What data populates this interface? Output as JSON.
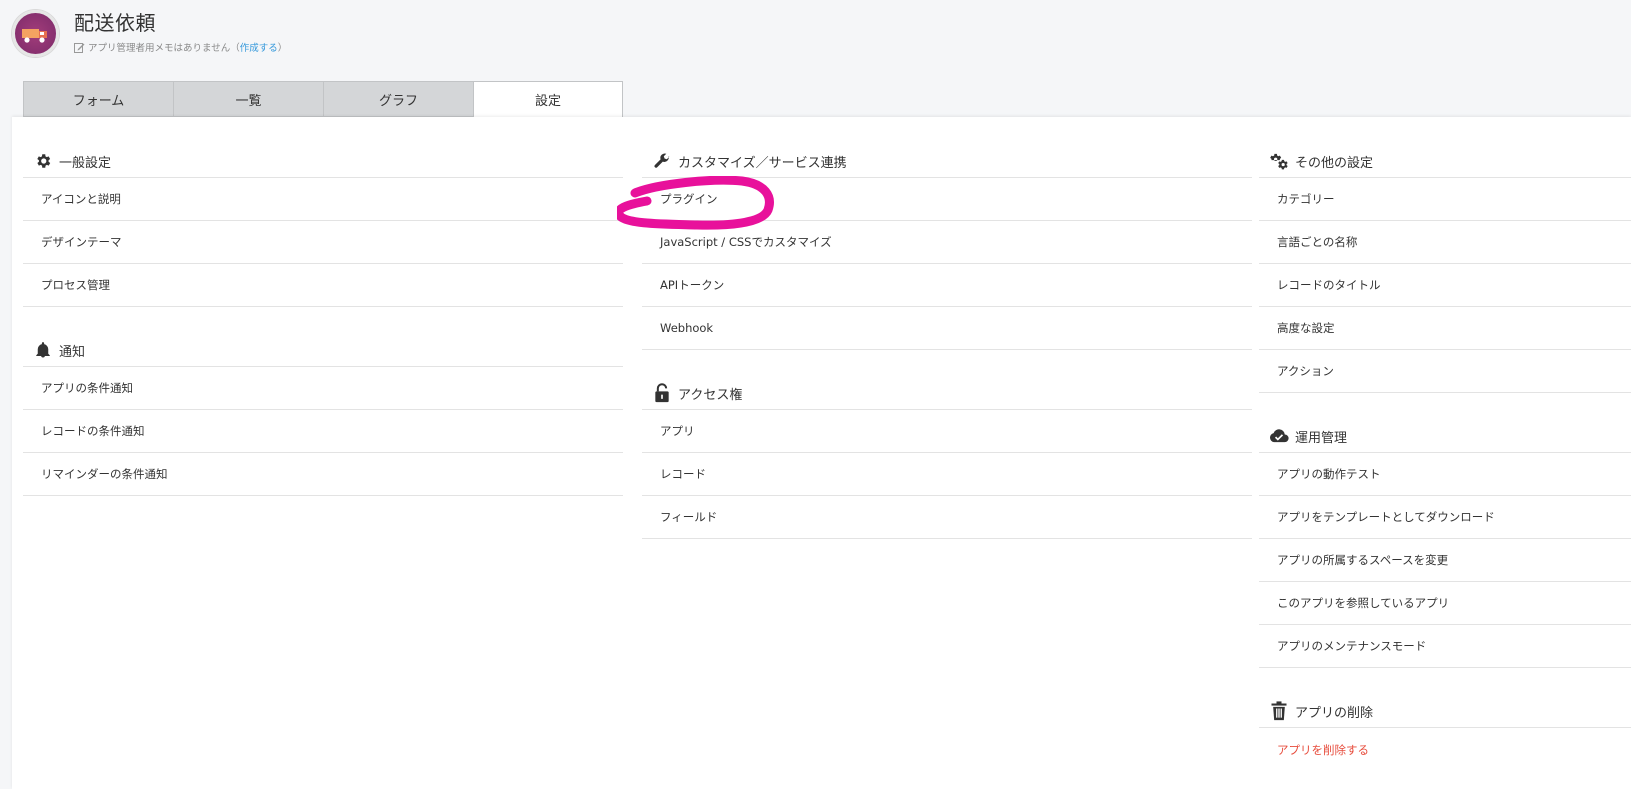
{
  "app": {
    "title": "配送依頼",
    "memo_text": "アプリ管理者用メモはありません",
    "memo_open": "（",
    "memo_link": "作成する",
    "memo_close": "）"
  },
  "tabs": [
    {
      "label": "フォーム"
    },
    {
      "label": "一覧"
    },
    {
      "label": "グラフ"
    },
    {
      "label": "設定"
    }
  ],
  "columns": {
    "general": {
      "title": "一般設定",
      "icon": "gear-icon",
      "items": [
        "アイコンと説明",
        "デザインテーマ",
        "プロセス管理"
      ]
    },
    "notify": {
      "title": "通知",
      "icon": "bell-icon",
      "items": [
        "アプリの条件通知",
        "レコードの条件通知",
        "リマインダーの条件通知"
      ]
    },
    "customize": {
      "title": "カスタマイズ／サービス連携",
      "icon": "wrench-icon",
      "items": [
        "プラグイン",
        "JavaScript / CSSでカスタマイズ",
        "APIトークン",
        "Webhook"
      ]
    },
    "access": {
      "title": "アクセス権",
      "icon": "unlock-icon",
      "items": [
        "アプリ",
        "レコード",
        "フィールド"
      ]
    },
    "other": {
      "title": "その他の設定",
      "icon": "gears-icon",
      "items": [
        "カテゴリー",
        "言語ごとの名称",
        "レコードのタイトル",
        "高度な設定",
        "アクション"
      ]
    },
    "operation": {
      "title": "運用管理",
      "icon": "cloud-check-icon",
      "items": [
        "アプリの動作テスト",
        "アプリをテンプレートとしてダウンロード",
        "アプリの所属するスペースを変更",
        "このアプリを参照しているアプリ",
        "アプリのメンテナンスモード"
      ]
    },
    "delete": {
      "title": "アプリの削除",
      "icon": "trash-icon",
      "items": [
        "アプリを削除する"
      ]
    }
  },
  "colors": {
    "annotation": "#e8119b",
    "danger": "#e74c3c",
    "link": "#3498db"
  }
}
